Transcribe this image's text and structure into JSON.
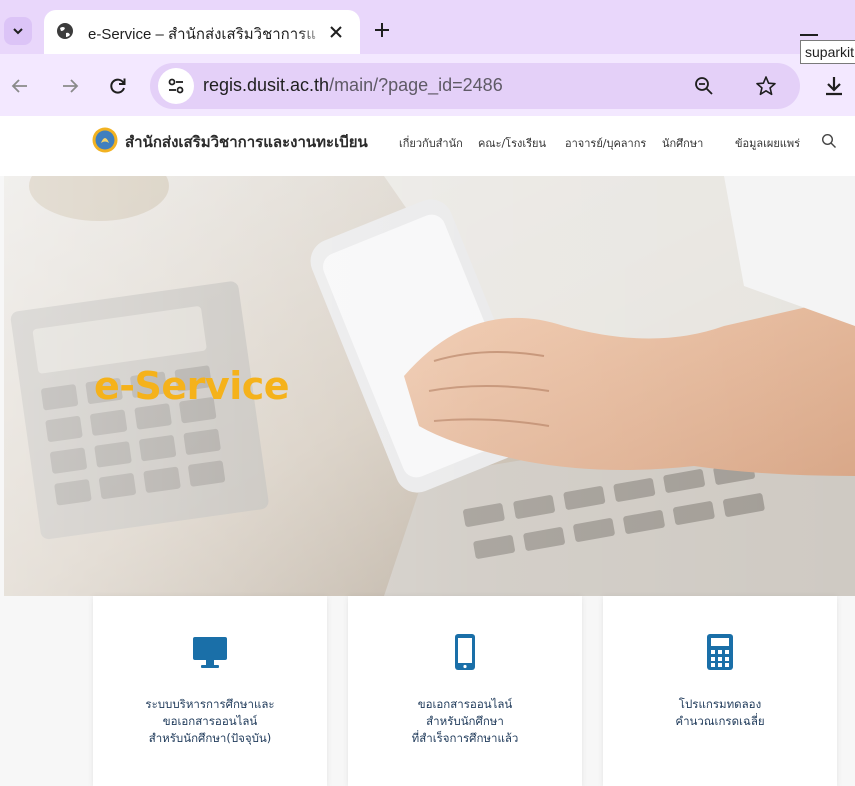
{
  "browser": {
    "tab_title": "e-Service – สำนักส่งเสริมวิชาการแ",
    "url_host": "regis.dusit.ac.th",
    "url_path": "/main/?page_id=2486",
    "profile_tooltip": "suparkit"
  },
  "site": {
    "title": "สำนักส่งเสริมวิชาการและงานทะเบียน",
    "nav": [
      "เกี่ยวกับสำนัก",
      "คณะ/โรงเรียน",
      "อาจารย์/บุคลากร",
      "นักศึกษา",
      "ข้อมูลเผยแพร่"
    ]
  },
  "hero": {
    "title": "e-Service"
  },
  "cards": [
    {
      "icon": "monitor-icon",
      "lines": [
        "ระบบบริหารการศึกษาและ",
        "ขอเอกสารออนไลน์",
        "สำหรับนักศึกษา(ปัจจุบัน)"
      ]
    },
    {
      "icon": "mobile-phone-icon",
      "lines": [
        "ขอเอกสารออนไลน์",
        "สำหรับนักศึกษา",
        "ที่สำเร็จการศึกษาแล้ว"
      ]
    },
    {
      "icon": "calculator-icon",
      "lines": [
        "โปรแกรมทดลอง",
        "คำนวณเกรดเฉลี่ย"
      ]
    }
  ],
  "colors": {
    "tabstrip": "#e9d7fb",
    "toolbar": "#f3e8ff",
    "omnibox": "#e4d0f8",
    "hero_title": "#f5b21b",
    "card_icon": "#1a6fa8",
    "card_text": "#1f3a5a"
  }
}
